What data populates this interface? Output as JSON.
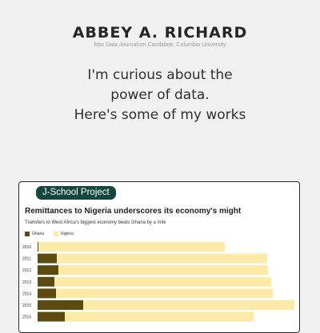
{
  "header": {
    "name": "ABBEY A. RICHARD",
    "subtitle": "Msc Data Journalism Candidate, Columbia University"
  },
  "intro": {
    "line1": "I'm curious about the",
    "line2": "power of data.",
    "line3": "Here's some of my works"
  },
  "card": {
    "badge": "J-School Project",
    "colors": {
      "ghana": "#5c4a10",
      "nigeria": "#fde9a8"
    }
  },
  "chart_data": {
    "type": "bar",
    "stacked": true,
    "orientation": "horizontal",
    "title": "Remittances to Nigeria underscores its economy's might",
    "subtitle": "Transfers to West Africa's biggest economy beats Ghana by a mile",
    "legend": [
      "Ghana",
      "Nigeria"
    ],
    "categories": [
      "2010",
      "2011",
      "2012",
      "2013",
      "2014",
      "2015",
      "2016"
    ],
    "series": [
      {
        "name": "Ghana",
        "values": [
          0.1,
          2.4,
          2.6,
          2.1,
          2.3,
          5.7,
          3.4
        ]
      },
      {
        "name": "Nigeria",
        "values": [
          23.3,
          26.3,
          26.2,
          27.1,
          27.1,
          26.4,
          23.6
        ]
      }
    ]
  }
}
